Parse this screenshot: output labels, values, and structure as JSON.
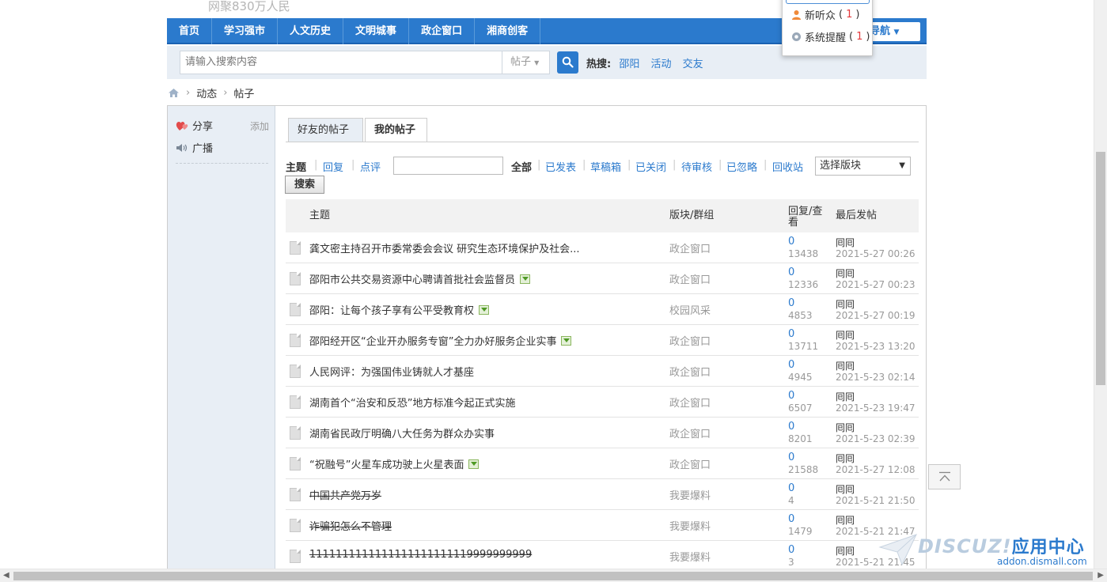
{
  "header": {
    "slogan": "网聚830万人民"
  },
  "nav": {
    "items": [
      "首页",
      "学习强市",
      "人文历史",
      "文明城事",
      "政企窗口",
      "湘商创客"
    ],
    "right_label": "导航"
  },
  "search": {
    "placeholder": "请输入搜索内容",
    "type": "帖子",
    "hot_label": "热搜:",
    "hot_items": [
      "邵阳",
      "活动",
      "交友"
    ]
  },
  "breadcrumb": {
    "items": [
      "动态",
      "帖子"
    ]
  },
  "sidebar": {
    "items": [
      {
        "label": "分享",
        "icon": "heart-share-icon"
      },
      {
        "label": "广播",
        "icon": "speaker-icon"
      }
    ],
    "add_label": "添加"
  },
  "tabs": {
    "items": [
      "好友的帖子",
      "我的帖子"
    ],
    "active": "我的帖子"
  },
  "filters": {
    "types": [
      "主题",
      "回复",
      "点评"
    ],
    "statuses": [
      "全部",
      "已发表",
      "草稿箱",
      "已关闭",
      "待审核",
      "已忽略",
      "回收站"
    ],
    "select_value": "选择版块",
    "search_label": "搜索"
  },
  "table": {
    "headers": {
      "subject": "主题",
      "forum": "版块/群组",
      "replies_views": "回复/查看",
      "lastpost": "最后发帖"
    },
    "rows": [
      {
        "title": "龚文密主持召开市委常委会会议 研究生态环境保护及社会...",
        "has_image": false,
        "strike": false,
        "forum": "政企窗口",
        "replies": "0",
        "views": "13438",
        "last_user": "囘囘",
        "last_time": "2021-5-27 00:26"
      },
      {
        "title": "邵阳市公共交易资源中心聘请首批社会监督员",
        "has_image": true,
        "strike": false,
        "forum": "政企窗口",
        "replies": "0",
        "views": "12336",
        "last_user": "囘囘",
        "last_time": "2021-5-27 00:23"
      },
      {
        "title": "邵阳：让每个孩子享有公平受教育权",
        "has_image": true,
        "strike": false,
        "forum": "校园风采",
        "replies": "0",
        "views": "4853",
        "last_user": "囘囘",
        "last_time": "2021-5-27 00:19"
      },
      {
        "title": "邵阳经开区“企业开办服务专窗”全力办好服务企业实事",
        "has_image": true,
        "strike": false,
        "forum": "政企窗口",
        "replies": "0",
        "views": "13711",
        "last_user": "囘囘",
        "last_time": "2021-5-23 13:20"
      },
      {
        "title": "人民网评：为强国伟业铸就人才基座",
        "has_image": false,
        "strike": false,
        "forum": "政企窗口",
        "replies": "0",
        "views": "4945",
        "last_user": "囘囘",
        "last_time": "2021-5-23 02:14"
      },
      {
        "title": "湖南首个“治安和反恐”地方标准今起正式实施",
        "has_image": false,
        "strike": false,
        "forum": "政企窗口",
        "replies": "0",
        "views": "6507",
        "last_user": "囘囘",
        "last_time": "2021-5-23 19:47"
      },
      {
        "title": "湖南省民政厅明确八大任务为群众办实事",
        "has_image": false,
        "strike": false,
        "forum": "政企窗口",
        "replies": "0",
        "views": "8201",
        "last_user": "囘囘",
        "last_time": "2021-5-23 02:39"
      },
      {
        "title": "“祝融号”火星车成功驶上火星表面",
        "has_image": true,
        "strike": false,
        "forum": "政企窗口",
        "replies": "0",
        "views": "21588",
        "last_user": "囘囘",
        "last_time": "2021-5-27 12:08"
      },
      {
        "title": "中国共产党万岁",
        "has_image": false,
        "strike": true,
        "forum": "我要爆料",
        "replies": "0",
        "views": "4",
        "last_user": "囘囘",
        "last_time": "2021-5-21 21:50"
      },
      {
        "title": "诈骗犯怎么不管理",
        "has_image": false,
        "strike": true,
        "forum": "我要爆料",
        "replies": "0",
        "views": "1479",
        "last_user": "囘囘",
        "last_time": "2021-5-21 21:47"
      },
      {
        "title": "1111111111111111111111119999999999",
        "has_image": false,
        "strike": true,
        "forum": "我要爆料",
        "replies": "0",
        "views": "3",
        "last_user": "囘囘",
        "last_time": "2021-5-21 21:45"
      }
    ]
  },
  "popup": {
    "items": [
      {
        "label": "新听众",
        "count": "1",
        "icon": "user-icon"
      },
      {
        "label": "系统提醒",
        "count": "1",
        "icon": "gear-icon"
      }
    ]
  },
  "watermark": {
    "brand": "DISCUZ!",
    "brand_cn": "应用中心",
    "url": "addon.dismall.com"
  },
  "colors": {
    "accent": "#2b7acd",
    "sidebar_bg": "#e8eef5",
    "alert": "#e4393c"
  }
}
